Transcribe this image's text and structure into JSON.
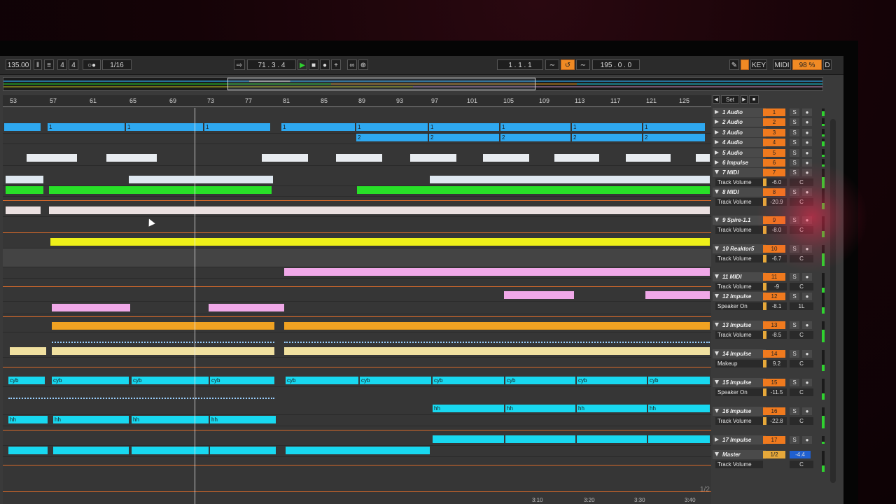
{
  "toolbar": {
    "tempo": "135.00",
    "time_sig_num": "4",
    "time_sig_den": "4",
    "quantize": "1/16",
    "arrangement_position": "71 . 3 . 4",
    "loop_start": "1 . 1 . 1",
    "loop_length": "195 . 0 . 0",
    "key_label": "KEY",
    "midi_label": "MIDI",
    "cpu_label": "98 %",
    "d_label": "D"
  },
  "ruler": {
    "bars": [
      "53",
      "57",
      "61",
      "65",
      "69",
      "73",
      "77",
      "81",
      "85",
      "89",
      "93",
      "97",
      "101",
      "105",
      "109",
      "113",
      "117",
      "121",
      "125"
    ]
  },
  "set_button": "Set",
  "clip_labels": {
    "cyb": "cyb",
    "hh": "hh",
    "one": "1",
    "two": "2"
  },
  "tracks": [
    {
      "name": "1 Audio",
      "num": "1",
      "solo": "S"
    },
    {
      "name": "2 Audio",
      "num": "2",
      "solo": "S"
    },
    {
      "name": "3 Audio",
      "num": "3",
      "solo": "S"
    },
    {
      "name": "4 Audio",
      "num": "4",
      "solo": "S"
    },
    {
      "name": "5 Audio",
      "num": "5",
      "solo": "S"
    },
    {
      "name": "6 Impulse",
      "num": "6",
      "solo": "S"
    },
    {
      "name": "7 MIDI",
      "num": "7",
      "solo": "S",
      "param": "Track Volume",
      "vol": "-6.0",
      "pan": "C"
    },
    {
      "name": "8 MIDI",
      "num": "8",
      "solo": "S",
      "param": "Track Volume",
      "vol": "-20.9",
      "pan": "C"
    },
    {
      "name": "9 Spire-1.1",
      "num": "9",
      "solo": "S",
      "param": "Track Volume",
      "vol": "-8.0",
      "pan": "C"
    },
    {
      "name": "10 Reaktor5",
      "num": "10",
      "solo": "S",
      "param": "Track Volume",
      "vol": "-6.7",
      "pan": "C"
    },
    {
      "name": "11 MIDI",
      "num": "11",
      "solo": "S",
      "param": "Track Volume",
      "vol": "-9",
      "pan": "C"
    },
    {
      "name": "12 Impulse",
      "num": "12",
      "solo": "S",
      "param": "Speaker On",
      "vol": "-8.1",
      "pan": "1L"
    },
    {
      "name": "13 Impulse",
      "num": "13",
      "solo": "S",
      "param": "Track Volume",
      "vol": "-8.5",
      "pan": "C"
    },
    {
      "name": "14 Impulse",
      "num": "14",
      "solo": "S",
      "param": "Makeup",
      "vol": "9.2",
      "pan": "C"
    },
    {
      "name": "15 Impulse",
      "num": "15",
      "solo": "S",
      "param": "Speaker On",
      "vol": "-11.5",
      "pan": "C"
    },
    {
      "name": "16 Impulse",
      "num": "16",
      "solo": "S",
      "param": "Track Volume",
      "vol": "-22.8",
      "pan": "C"
    },
    {
      "name": "17 Impulse",
      "num": "17",
      "solo": "S"
    },
    {
      "name": "Master",
      "num": "1/2",
      "solo": "-4.4",
      "param": "Track Volume",
      "pan": "C"
    }
  ],
  "footer": {
    "page": "1/2",
    "times": [
      "3:10",
      "3:20",
      "3:30",
      "3:40"
    ]
  },
  "colors": {
    "blue": "#2ea8f0",
    "green": "#28e028",
    "yellow": "#eef019",
    "pink": "#f0a8e8",
    "orange": "#f0a222",
    "cream": "#f0e0a0",
    "cyan": "#18d8f0",
    "white": "#e8ecf0"
  }
}
